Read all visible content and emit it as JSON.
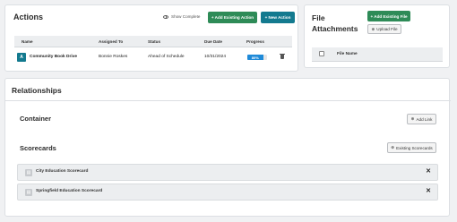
{
  "actions": {
    "title": "Actions",
    "show_complete_label": "Show Complete",
    "add_existing_label": "+ Add Existing Action",
    "new_action_label": "+ New Action",
    "columns": [
      "Name",
      "Assigned To",
      "Status",
      "Due Date",
      "Progress"
    ],
    "rows": [
      {
        "badge": "A",
        "name": "Community Book Drive",
        "assigned_to": "Bonnie Roskes",
        "status": "Ahead of Schedule",
        "due_date": "10/31/2024",
        "progress_label": "80%",
        "progress": 0.8
      }
    ]
  },
  "file_attachments": {
    "title": "File Attachments",
    "add_existing_label": "+ Add Existing File",
    "upload_label": "Upload File",
    "column_file_name": "File Name"
  },
  "relationships": {
    "title": "Relationships",
    "container_label": "Container",
    "add_link_label": "Add Link",
    "scorecards_label": "Scorecards",
    "existing_scorecards_label": "Existing Scorecards",
    "scorecards": [
      {
        "name": "City Education Scorecard"
      },
      {
        "name": "Springfield Education Scorecard"
      }
    ]
  },
  "colors": {
    "green": "#2e8b57",
    "teal": "#137a8f",
    "progress_blue": "#1f8ad8"
  },
  "icons": {
    "show_complete": "eye-icon",
    "trash": "trash-icon",
    "add": "plus-circle-icon",
    "upload": "upload-icon",
    "close": "close-icon",
    "scorecard": "scorecard-icon"
  }
}
